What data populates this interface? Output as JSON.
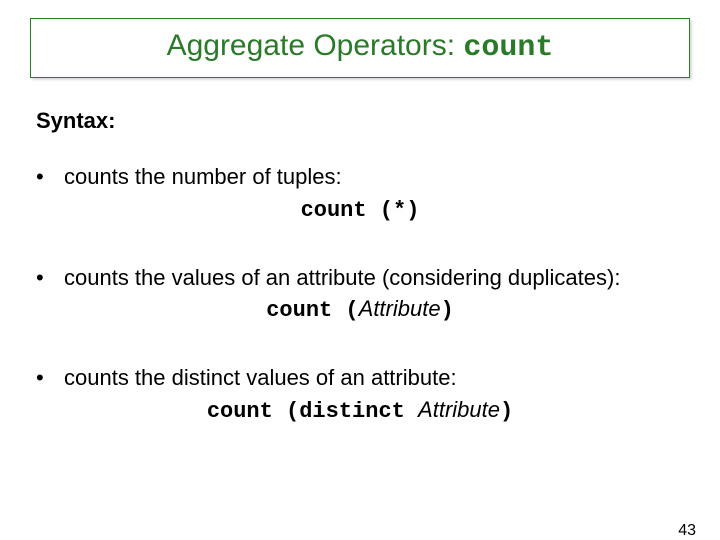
{
  "title": {
    "prefix": "Aggregate Operators: ",
    "mono": "count"
  },
  "syntax_label": "Syntax:",
  "bullets": [
    {
      "text": "counts the number of tuples:",
      "code_mono_pre": "count (*)",
      "code_ital": "",
      "code_mono_post": ""
    },
    {
      "text": "counts the values of an attribute (considering duplicates):",
      "code_mono_pre": "count (",
      "code_ital": "Attribute",
      "code_mono_post": ")"
    },
    {
      "text": "counts the distinct values of an attribute:",
      "code_mono_pre": "count (distinct ",
      "code_ital": "Attribute",
      "code_mono_post": ")"
    }
  ],
  "page_number": "43"
}
